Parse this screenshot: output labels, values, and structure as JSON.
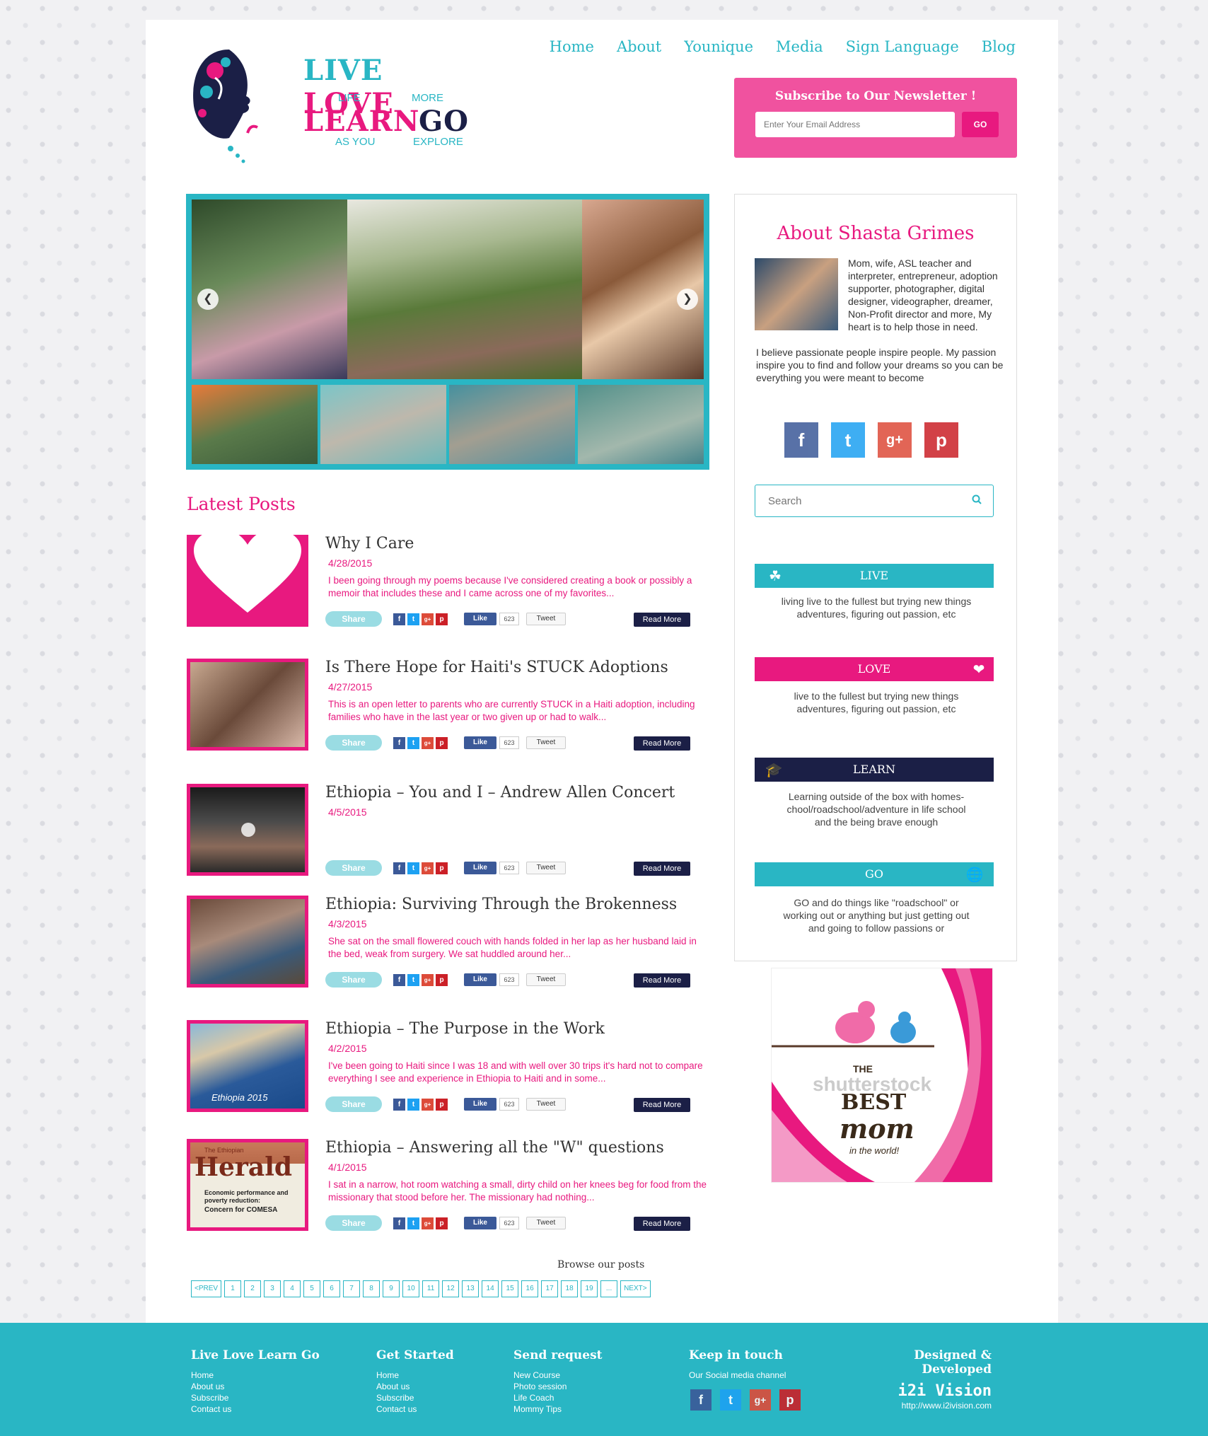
{
  "logo": {
    "line1": "LIVE LOVE",
    "sub1a": "LIFE",
    "sub1b": "MORE",
    "line2a": "LEARN",
    "line2b": "GO",
    "sub2a": "AS YOU",
    "sub2b": "EXPLORE"
  },
  "nav": [
    "Home",
    "About",
    "Younique",
    "Media",
    "Sign Language",
    "Blog"
  ],
  "newsletter": {
    "title": "Subscribe to Our Newsletter !",
    "placeholder": "Enter Your Email Address",
    "button": "GO"
  },
  "latest_title": "Latest Posts",
  "share": {
    "share": "Share",
    "like": "Like",
    "count": "623",
    "tweet": "Tweet",
    "read_more": "Read More"
  },
  "posts": [
    {
      "title": "Why I Care",
      "date": "4/28/2015",
      "excerpt": "I been going through my poems because I've considered creating a book or possibly a memoir that includes these and I came across one of my favorites..."
    },
    {
      "title": "Is There Hope for Haiti's STUCK Adoptions",
      "date": "4/27/2015",
      "excerpt": "This is an open letter to parents who are currently STUCK in a Haiti adoption, including families who have in the last year or two given up or had to walk..."
    },
    {
      "title": "Ethiopia – You and I – Andrew Allen Concert",
      "date": "4/5/2015",
      "excerpt": ""
    },
    {
      "title": "Ethiopia: Surviving Through the Brokenness",
      "date": "4/3/2015",
      "excerpt": "She sat on the small flowered couch with hands folded in her lap as her husband laid in the bed, weak from surgery.  We sat huddled around her..."
    },
    {
      "title": "Ethiopia – The Purpose in the Work",
      "date": "4/2/2015",
      "excerpt": "I've been going to Haiti since I was 18 and with well over 30 trips it's hard not to compare everything I see and experience in Ethiopia to Haiti and in some..."
    },
    {
      "title": "Ethiopia – Answering all the \"W\" questions",
      "date": "4/1/2015",
      "excerpt": "I sat in a narrow, hot room watching a small, dirty child on her knees beg for food from the missionary that stood before her.  The missionary had nothing..."
    }
  ],
  "thumb_texts": {
    "ethiopia2015": "Ethiopia 2015",
    "herald1": "The Ethiopian",
    "herald2": "Herald",
    "herald3": "Economic performance and poverty reduction:",
    "herald4": "Concern for COMESA"
  },
  "browse": "Browse our posts",
  "pagination": [
    "<PREV",
    "1",
    "2",
    "3",
    "4",
    "5",
    "6",
    "7",
    "8",
    "9",
    "10",
    "11",
    "12",
    "13",
    "14",
    "15",
    "16",
    "17",
    "18",
    "19",
    "...",
    "NEXT>"
  ],
  "about": {
    "title": "About Shasta Grimes",
    "text1": "Mom, wife, ASL teacher and interpreter, entrepreneur, adoption supporter, photographer, digital designer, videographer, dreamer, Non-Profit director and more, My heart is to help those in need.",
    "text2": " I believe passionate people inspire people.  My passion inspire you to find and follow your dreams so you can be everything you were meant to become"
  },
  "search_placeholder": "Search",
  "categories": [
    {
      "label": "LIVE",
      "text": "living live to the fullest but trying new things adventures, figuring out passion, etc",
      "color": "#29b6c4"
    },
    {
      "label": "LOVE",
      "text": "live to the fullest but trying new things adventures, figuring out passion, etc",
      "color": "#e8197f"
    },
    {
      "label": "LEARN",
      "text": "Learning outside of the box with homes-chool/roadschool/adventure in life school and the being brave enough",
      "color": "#1b1f46"
    },
    {
      "label": "GO",
      "text": "GO and do things like \"roadschool\" or working out or anything but just getting out and going to follow passions or",
      "color": "#29b6c4"
    }
  ],
  "ad": {
    "watermark": "shutterstock",
    "the": "THE",
    "best": "BEST",
    "mom": "mom",
    "world": "in the world!"
  },
  "footer": {
    "col1": {
      "title": "Live Love Learn Go",
      "links": [
        "Home",
        "About us",
        "Subscribe",
        "Contact us"
      ]
    },
    "col2": {
      "title": "Get Started",
      "links": [
        "Home",
        "About us",
        "Subscribe",
        "Contact us"
      ]
    },
    "col3": {
      "title": "Send request",
      "links": [
        "New Course",
        "Photo session",
        "Life Coach",
        "Mommy Tips"
      ]
    },
    "col4": {
      "title": "Keep in touch",
      "sub": "Our Social media channel"
    },
    "col5": {
      "title": "Designed & Developed",
      "brand": "i2i Vision",
      "url": "http://www.i2ivision.com"
    }
  },
  "colors": {
    "pink": "#e8197f",
    "teal": "#29b6c4",
    "navy": "#1b1f46",
    "newsletter": "#f0529f"
  },
  "icons": [
    "facebook-icon",
    "twitter-icon",
    "google-plus-icon",
    "pinterest-icon",
    "search-icon",
    "tree-icon",
    "heart-icon",
    "graduation-cap-icon",
    "globe-icon"
  ]
}
